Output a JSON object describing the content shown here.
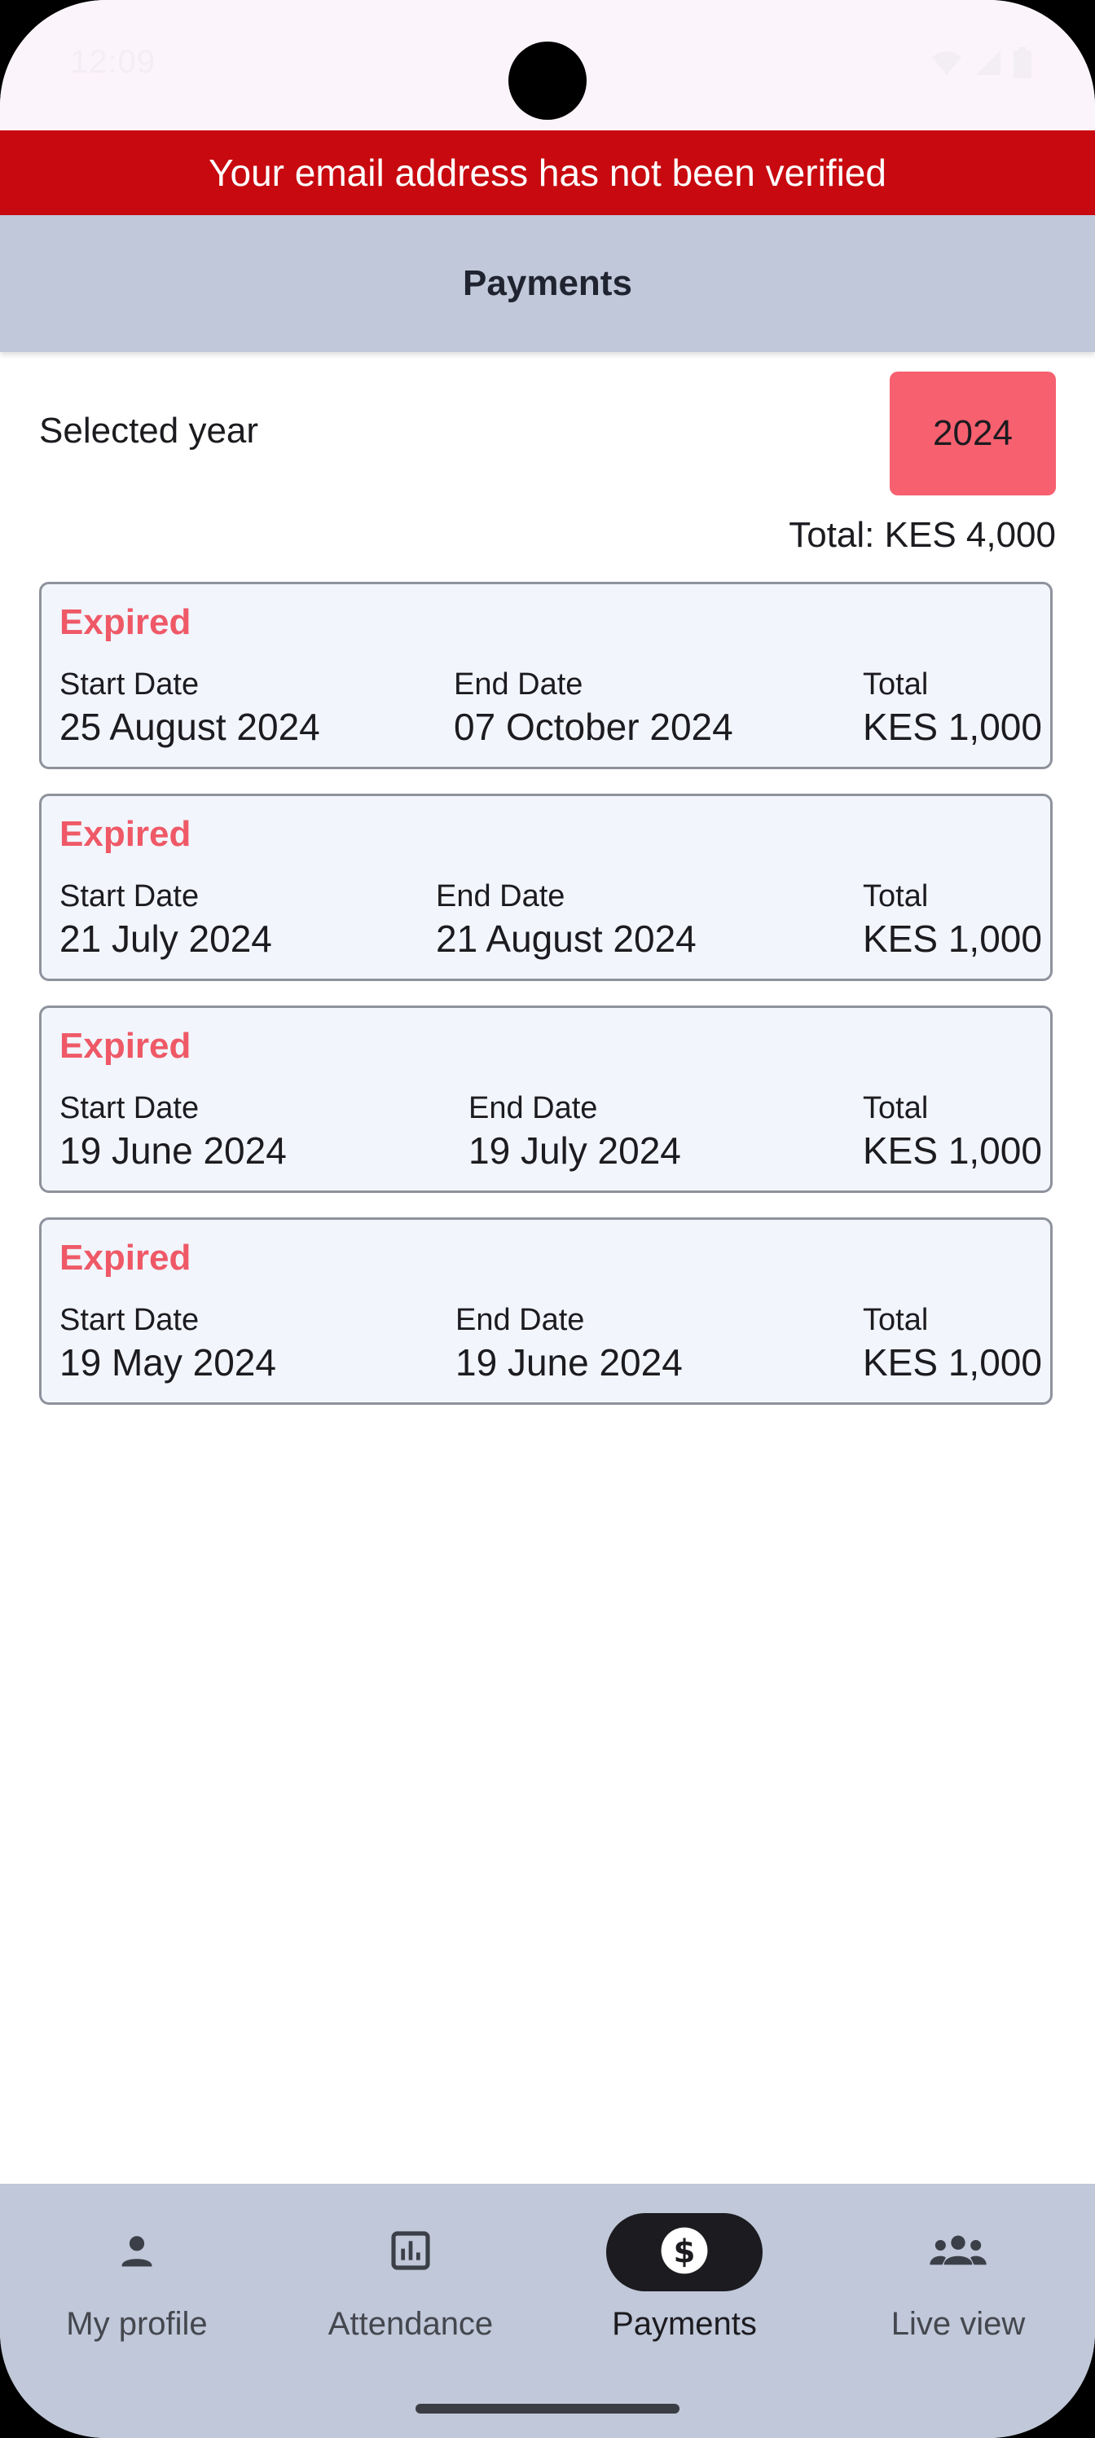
{
  "status_bar": {
    "time": "12:09"
  },
  "banner": {
    "text": "Your email address has not been verified"
  },
  "app_bar": {
    "title": "Payments"
  },
  "year_selector": {
    "label": "Selected year",
    "value": "2024"
  },
  "summary": {
    "total": "Total: KES 4,000"
  },
  "labels": {
    "start": "Start Date",
    "end": "End Date",
    "total": "Total"
  },
  "payments": [
    {
      "status": "Expired",
      "start": "25 August 2024",
      "end": "07 October 2024",
      "total": "KES 1,000"
    },
    {
      "status": "Expired",
      "start": "21 July 2024",
      "end": "21 August 2024",
      "total": "KES 1,000"
    },
    {
      "status": "Expired",
      "start": "19 June 2024",
      "end": "19 July 2024",
      "total": "KES 1,000"
    },
    {
      "status": "Expired",
      "start": "19 May 2024",
      "end": "19 June 2024",
      "total": "KES 1,000"
    }
  ],
  "nav": {
    "items": [
      {
        "label": "My profile",
        "icon": "person-icon",
        "active": false
      },
      {
        "label": "Attendance",
        "icon": "bar-chart-icon",
        "active": false
      },
      {
        "label": "Payments",
        "icon": "dollar-icon",
        "active": true
      },
      {
        "label": "Live view",
        "icon": "group-icon",
        "active": false
      }
    ]
  },
  "colors": {
    "banner": "#c8090f",
    "app_bar": "#c0c8d9",
    "accent": "#f6606f",
    "expired": "#ef5967",
    "card_background": "#f2f5fc"
  }
}
